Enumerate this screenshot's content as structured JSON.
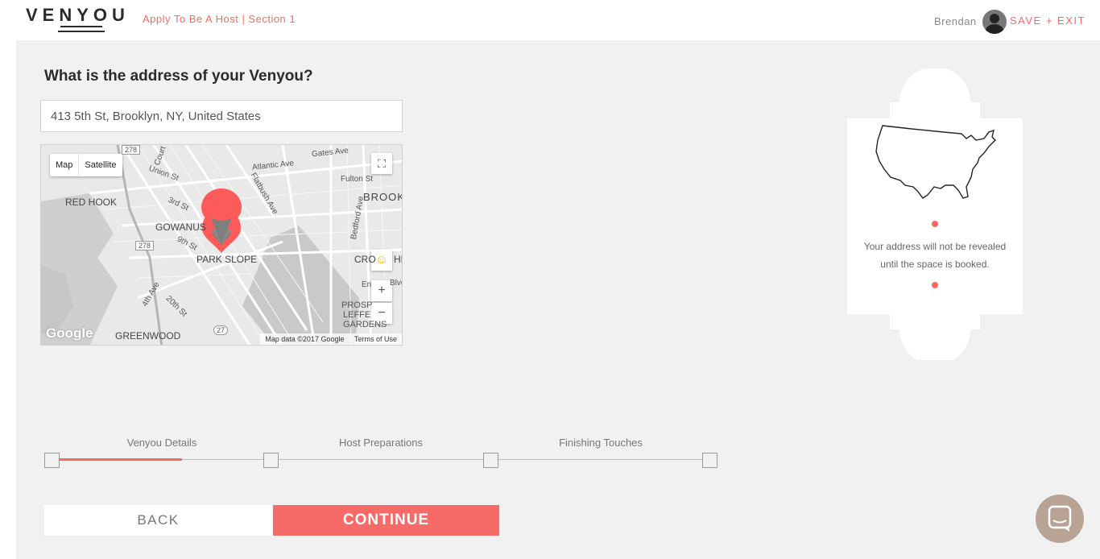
{
  "header": {
    "logo": "VENYOU",
    "breadcrumb": "Apply To Be A Host | Section 1",
    "user_name": "Brendan",
    "save_exit": "SAVE + EXIT"
  },
  "main": {
    "question": "What is the address of your Venyou?",
    "address_value": "413 5th St, Brooklyn, NY, United States"
  },
  "map": {
    "type_buttons": [
      "Map",
      "Satellite"
    ],
    "labels": [
      "RED HOOK",
      "GOWANUS",
      "PARK SLOPE",
      "GREENWOOD",
      "BROOK",
      "CRO",
      "HE",
      "PROSP",
      "LEFFE",
      "GARDENS"
    ],
    "streets": [
      "Gates Ave",
      "Atlantic Ave",
      "Fulton St",
      "Union St",
      "3rd St",
      "9th St",
      "Flatbush Ave",
      "Bedford Ave",
      "4th Ave",
      "20th St",
      "Court",
      "En",
      "Blvd"
    ],
    "route_shields": [
      "278",
      "278",
      "27"
    ],
    "google_logo": "Google",
    "footer_data": "Map data ©2017 Google",
    "footer_terms": "Terms of Use",
    "zoom_in": "+",
    "zoom_out": "−",
    "pin_color": "#fd5b5a"
  },
  "info_card": {
    "message_line1": "Your address will not be revealed",
    "message_line2": "until the space is booked."
  },
  "progress": {
    "steps": [
      "Venyou Details",
      "Host Preparations",
      "Finishing Touches"
    ],
    "completed_fraction": 0.5
  },
  "buttons": {
    "back": "BACK",
    "continue": "CONTINUE"
  },
  "colors": {
    "accent": "#f26b65",
    "panel_bg": "#f1f1f1",
    "chat_bubble": "#b8a395"
  }
}
